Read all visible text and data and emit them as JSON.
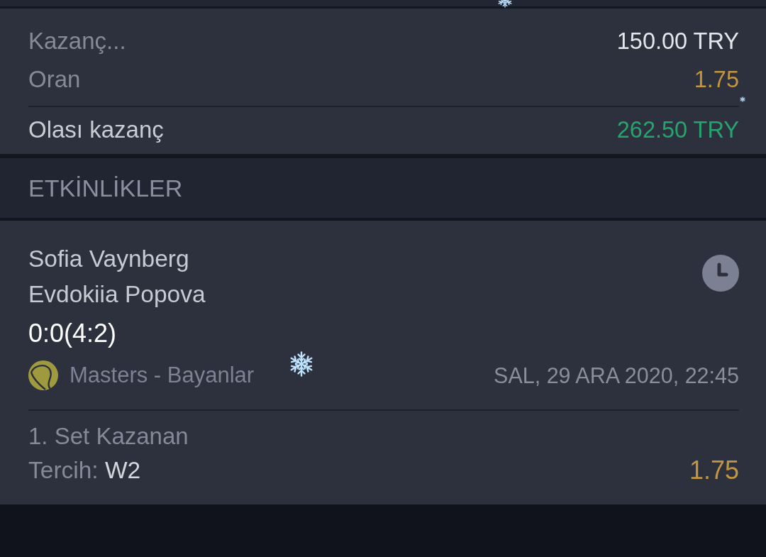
{
  "summary": {
    "rows": [
      {
        "kind": "stake",
        "label": "Kazanç...",
        "value": "150.00 TRY"
      },
      {
        "kind": "odds",
        "label": "Oran",
        "value": "1.75"
      },
      {
        "kind": "win",
        "label": "Olası kazanç",
        "value": "262.50 TRY"
      }
    ]
  },
  "events_header": {
    "title": "ETKİNLİKLER"
  },
  "event": {
    "team_1": "Sofia Vaynberg",
    "team_2": "Evdokiia Popova",
    "score": "0:0(4:2)",
    "league": "Masters - Bayanlar",
    "date": "SAL, 29 ARA 2020, 22:45",
    "market": "1. Set Kazanan",
    "choice_label": "Tercih:",
    "choice": "W2",
    "odds": "1.75"
  }
}
